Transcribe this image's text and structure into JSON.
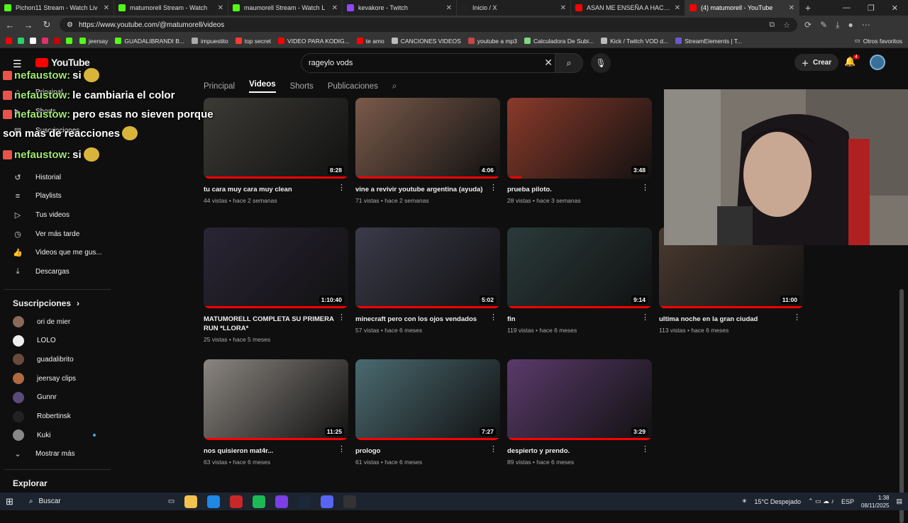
{
  "browser": {
    "tabs": [
      {
        "title": "Pichon11 Stream - Watch Liv",
        "color": "#53fc18"
      },
      {
        "title": "matumorell Stream - Watch",
        "color": "#53fc18"
      },
      {
        "title": "maumorell Stream - Watch L",
        "color": "#53fc18"
      },
      {
        "title": "kevakore - Twitch",
        "color": "#9146ff"
      },
      {
        "title": "Inicio / X",
        "color": "#222222"
      },
      {
        "title": "ASAN ME ENSEÑA A HACER BEA",
        "color": "#ff0000"
      },
      {
        "title": "(4) matumorell - YouTube",
        "color": "#ff0000"
      }
    ],
    "url": "https://www.youtube.com/@matumorell/videos",
    "bookmarks": [
      "jeersay",
      "GUADALIBRANDI B...",
      "impuestito",
      "top secret",
      "VIDEO PARA KODIG...",
      "te amo",
      "CANCIONES VIDEOS",
      "youtube a mp3",
      "Calculadora De Subi...",
      "Kick / Twitch VOD d...",
      "StreamElements | T..."
    ],
    "bookmarks_other": "Otros favoritos"
  },
  "youtube": {
    "logo": "YouTube",
    "search_value": "rageylo vods",
    "create_label": "Crear",
    "notif_count": "4",
    "channel_tabs": [
      "Principal",
      "Videos",
      "Shorts",
      "Publicaciones"
    ],
    "sidebar": {
      "main": [
        "Principal",
        "Shorts",
        "Suscripciones"
      ],
      "you": [
        "Historial",
        "Playlists",
        "Tus videos",
        "Ver más tarde",
        "Videos que me gus...",
        "Descargas"
      ],
      "subs_title": "Suscripciones",
      "subs": [
        "ori de mier",
        "LOLO",
        "guadalibrito",
        "jeersay clips",
        "Gunnr",
        "Robertinsk",
        "Kuki"
      ],
      "show_more": "Mostrar más",
      "explore": "Explorar"
    },
    "videos": [
      {
        "title": "tu cara muy cara muy clean",
        "meta": "44 vistas • hace 2 semanas",
        "duration": "8:28",
        "progress": 1.0,
        "color": "#3b3a35"
      },
      {
        "title": "vine a revivir youtube argentina (ayuda)",
        "meta": "71 vistas • hace 2 semanas",
        "duration": "4:06",
        "progress": 1.0,
        "color": "#7a5a4a"
      },
      {
        "title": "prueba piloto.",
        "meta": "28 vistas • hace 3 semanas",
        "duration": "3:48",
        "progress": 0.1,
        "color": "#8a3a2a"
      },
      {
        "title": "MATUMORELL COMPLETA SU PRIMERA RUN *LLORA*",
        "meta": "25 vistas • hace 5 meses",
        "duration": "1:10:40",
        "progress": 1.0,
        "color": "#2a2535"
      },
      {
        "title": "minecraft pero con los ojos vendados",
        "meta": "57 vistas • hace 6 meses",
        "duration": "5:02",
        "progress": 1.0,
        "color": "#3a3a4a"
      },
      {
        "title": "fin",
        "meta": "119 vistas • hace 6 meses",
        "duration": "9:14",
        "progress": 1.0,
        "color": "#2a3a3a"
      },
      {
        "title": "ultima noche en la gran ciudad",
        "meta": "113 vistas • hace 6 meses",
        "duration": "11:00",
        "progress": 1.0,
        "color": "#4a3a30"
      },
      {
        "title": "nos quisieron mat4r...",
        "meta": "63 vistas • hace 6 meses",
        "duration": "11:25",
        "progress": 1.0,
        "color": "#8a8580"
      },
      {
        "title": "prologo",
        "meta": "61 vistas • hace 6 meses",
        "duration": "7:27",
        "progress": 1.0,
        "color": "#4a6a70"
      },
      {
        "title": "despierto y prendo.",
        "meta": "89 vistas • hace 6 meses",
        "duration": "3:29",
        "progress": 1.0,
        "color": "#5a3a6a"
      }
    ]
  },
  "overlay": {
    "chat": [
      {
        "user": "nefaustow:",
        "text": "si"
      },
      {
        "user": "nefaustow:",
        "text": "le cambiaria el color"
      },
      {
        "user": "nefaustow:",
        "text": "pero esas no sieven porque"
      },
      {
        "user": "",
        "text": "son mas de reacciones"
      },
      {
        "user": "nefaustow:",
        "text": "si"
      }
    ]
  },
  "taskbar": {
    "search": "Buscar",
    "weather": "15°C Despejado",
    "lang": "ESP",
    "time": "1:38",
    "date": "08/11/2025"
  }
}
